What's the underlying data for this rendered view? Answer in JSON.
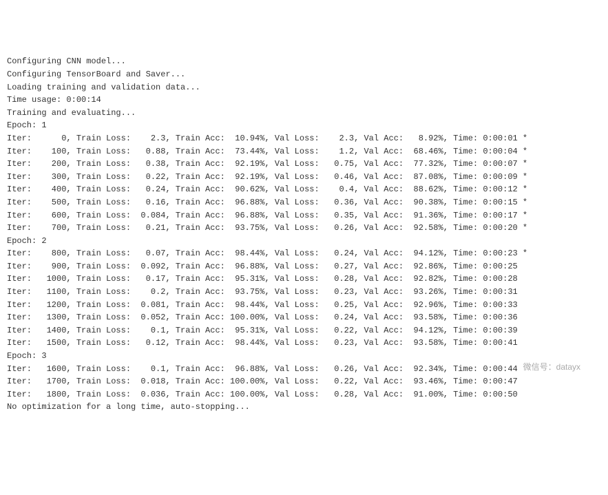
{
  "header": [
    "Configuring CNN model...",
    "Configuring TensorBoard and Saver...",
    "Loading training and validation data...",
    "Time usage: 0:00:14",
    "Training and evaluating..."
  ],
  "epochs": [
    {
      "label": "Epoch: 1",
      "rows": [
        {
          "iter": 0,
          "train_loss": "2.3",
          "train_acc": "10.94%",
          "val_loss": "2.3",
          "val_acc": "8.92%",
          "time": "0:00:01",
          "star": true
        },
        {
          "iter": 100,
          "train_loss": "0.88",
          "train_acc": "73.44%",
          "val_loss": "1.2",
          "val_acc": "68.46%",
          "time": "0:00:04",
          "star": true
        },
        {
          "iter": 200,
          "train_loss": "0.38",
          "train_acc": "92.19%",
          "val_loss": "0.75",
          "val_acc": "77.32%",
          "time": "0:00:07",
          "star": true
        },
        {
          "iter": 300,
          "train_loss": "0.22",
          "train_acc": "92.19%",
          "val_loss": "0.46",
          "val_acc": "87.08%",
          "time": "0:00:09",
          "star": true
        },
        {
          "iter": 400,
          "train_loss": "0.24",
          "train_acc": "90.62%",
          "val_loss": "0.4",
          "val_acc": "88.62%",
          "time": "0:00:12",
          "star": true
        },
        {
          "iter": 500,
          "train_loss": "0.16",
          "train_acc": "96.88%",
          "val_loss": "0.36",
          "val_acc": "90.38%",
          "time": "0:00:15",
          "star": true
        },
        {
          "iter": 600,
          "train_loss": "0.084",
          "train_acc": "96.88%",
          "val_loss": "0.35",
          "val_acc": "91.36%",
          "time": "0:00:17",
          "star": true
        },
        {
          "iter": 700,
          "train_loss": "0.21",
          "train_acc": "93.75%",
          "val_loss": "0.26",
          "val_acc": "92.58%",
          "time": "0:00:20",
          "star": true
        }
      ]
    },
    {
      "label": "Epoch: 2",
      "rows": [
        {
          "iter": 800,
          "train_loss": "0.07",
          "train_acc": "98.44%",
          "val_loss": "0.24",
          "val_acc": "94.12%",
          "time": "0:00:23",
          "star": true
        },
        {
          "iter": 900,
          "train_loss": "0.092",
          "train_acc": "96.88%",
          "val_loss": "0.27",
          "val_acc": "92.86%",
          "time": "0:00:25",
          "star": false
        },
        {
          "iter": 1000,
          "train_loss": "0.17",
          "train_acc": "95.31%",
          "val_loss": "0.28",
          "val_acc": "92.82%",
          "time": "0:00:28",
          "star": false
        },
        {
          "iter": 1100,
          "train_loss": "0.2",
          "train_acc": "93.75%",
          "val_loss": "0.23",
          "val_acc": "93.26%",
          "time": "0:00:31",
          "star": false
        },
        {
          "iter": 1200,
          "train_loss": "0.081",
          "train_acc": "98.44%",
          "val_loss": "0.25",
          "val_acc": "92.96%",
          "time": "0:00:33",
          "star": false
        },
        {
          "iter": 1300,
          "train_loss": "0.052",
          "train_acc": "100.00%",
          "val_loss": "0.24",
          "val_acc": "93.58%",
          "time": "0:00:36",
          "star": false
        },
        {
          "iter": 1400,
          "train_loss": "0.1",
          "train_acc": "95.31%",
          "val_loss": "0.22",
          "val_acc": "94.12%",
          "time": "0:00:39",
          "star": false
        },
        {
          "iter": 1500,
          "train_loss": "0.12",
          "train_acc": "98.44%",
          "val_loss": "0.23",
          "val_acc": "93.58%",
          "time": "0:00:41",
          "star": false
        }
      ]
    },
    {
      "label": "Epoch: 3",
      "rows": [
        {
          "iter": 1600,
          "train_loss": "0.1",
          "train_acc": "96.88%",
          "val_loss": "0.26",
          "val_acc": "92.34%",
          "time": "0:00:44",
          "star": false
        },
        {
          "iter": 1700,
          "train_loss": "0.018",
          "train_acc": "100.00%",
          "val_loss": "0.22",
          "val_acc": "93.46%",
          "time": "0:00:47",
          "star": false
        },
        {
          "iter": 1800,
          "train_loss": "0.036",
          "train_acc": "100.00%",
          "val_loss": "0.28",
          "val_acc": "91.00%",
          "time": "0:00:50",
          "star": false
        }
      ]
    }
  ],
  "footer": "No optimization for a long time, auto-stopping...",
  "watermark": "微信号：datayx"
}
